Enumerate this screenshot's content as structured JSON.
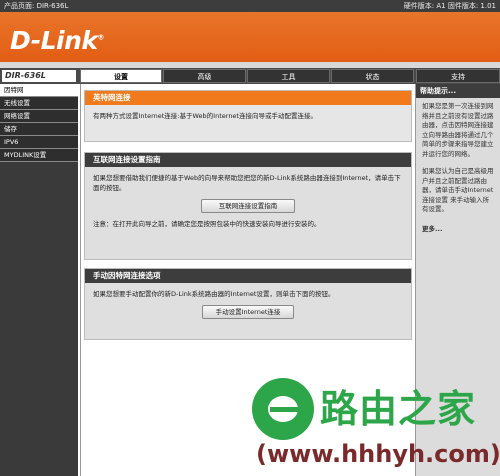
{
  "topbar": {
    "left": "产品页面: DIR-636L",
    "right": "硬件版本: A1   固件版本: 1.01"
  },
  "brand": {
    "logo": "D-Link",
    "mark": "®"
  },
  "model": "DIR-636L",
  "tabs": [
    "设置",
    "高级",
    "工具",
    "状态",
    "支持"
  ],
  "sidebar": {
    "items": [
      "因特网",
      "无线设置",
      "网络设置",
      "储存",
      "IPV6",
      "MYDLINK设置"
    ]
  },
  "internet": {
    "title": "英特网连接",
    "desc": "有两种方式设置Internet连接:基于Web的Internet连接向导或手动配置连接。"
  },
  "wizard": {
    "title": "互联网连接设置指南",
    "desc": "如果您想要借助我们便捷的基于Web的向导来帮助您把您的新D-Link系统路由器连接到Internet，请单击下面的按钮。",
    "button": "互联网连接设置指南",
    "note": "注意：在打开此向导之前，请确定您是按照包装中的快速安装向导进行安装的。"
  },
  "manual": {
    "title": "手动因特网连接选项",
    "desc": "如果您想要手动配置你的新D-Link系统路由器的Internet设置，则单击下面的按钮。",
    "button": "手动设置Internet连接"
  },
  "help": {
    "title": "帮助提示...",
    "p1": "如果您是第一次连接到网络并且之前没有设置过路由器，点击因特网连接建立向导路由器将通过几个简单的步骤来指导您建立并运行您的网络。",
    "p2": "如果您认为自己是高级用户并且之前配置过路由器，请单击手动Internet连接设置 来手动输入所有设置。",
    "more": "更多..."
  },
  "watermark": {
    "brand": "路由之家",
    "url": "(www.hhhyh.com)"
  }
}
